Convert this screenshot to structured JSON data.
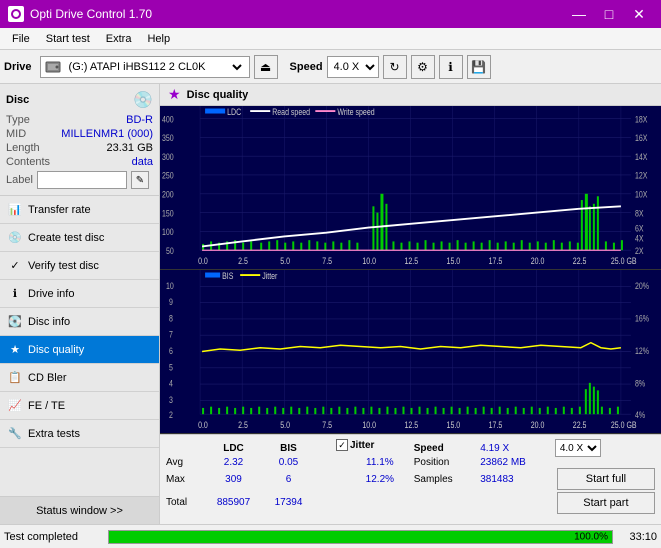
{
  "titlebar": {
    "title": "Opti Drive Control 1.70",
    "minimize": "—",
    "maximize": "□",
    "close": "✕"
  },
  "menu": {
    "items": [
      "File",
      "Start test",
      "Extra",
      "Help"
    ]
  },
  "toolbar": {
    "drive_label": "Drive",
    "drive_value": "(G:) ATAPI iHBS112  2 CL0K",
    "speed_label": "Speed",
    "speed_value": "4.0 X"
  },
  "disc_info": {
    "type_label": "Type",
    "type_value": "BD-R",
    "mid_label": "MID",
    "mid_value": "MILLENMR1 (000)",
    "length_label": "Length",
    "length_value": "23.31 GB",
    "contents_label": "Contents",
    "contents_value": "data",
    "label_label": "Label"
  },
  "nav_items": [
    {
      "label": "Transfer rate",
      "icon": "📊",
      "active": false
    },
    {
      "label": "Create test disc",
      "icon": "💿",
      "active": false
    },
    {
      "label": "Verify test disc",
      "icon": "✓",
      "active": false
    },
    {
      "label": "Drive info",
      "icon": "ℹ",
      "active": false
    },
    {
      "label": "Disc info",
      "icon": "💽",
      "active": false
    },
    {
      "label": "Disc quality",
      "icon": "★",
      "active": true
    },
    {
      "label": "CD Bler",
      "icon": "📋",
      "active": false
    },
    {
      "label": "FE / TE",
      "icon": "📈",
      "active": false
    },
    {
      "label": "Extra tests",
      "icon": "🔧",
      "active": false
    }
  ],
  "status_window": "Status window >>",
  "disc_quality": {
    "title": "Disc quality",
    "legend": {
      "ldc": "LDC",
      "read_speed": "Read speed",
      "write_speed": "Write speed"
    },
    "chart1": {
      "y_max": 400,
      "y_right_labels": [
        "18X",
        "16X",
        "14X",
        "12X",
        "10X",
        "8X",
        "6X",
        "4X",
        "2X"
      ],
      "x_labels": [
        "0.0",
        "2.5",
        "5.0",
        "7.5",
        "10.0",
        "12.5",
        "15.0",
        "17.5",
        "20.0",
        "22.5",
        "25.0 GB"
      ]
    },
    "chart2": {
      "title": "BIS",
      "title2": "Jitter",
      "y_max": 10,
      "y_right_labels": [
        "20%",
        "16%",
        "12%",
        "8%",
        "4%"
      ],
      "x_labels": [
        "0.0",
        "2.5",
        "5.0",
        "7.5",
        "10.0",
        "12.5",
        "15.0",
        "17.5",
        "20.0",
        "22.5",
        "25.0 GB"
      ]
    }
  },
  "stats": {
    "headers": [
      "LDC",
      "BIS",
      "",
      "Jitter",
      "Speed",
      ""
    ],
    "avg_label": "Avg",
    "avg_ldc": "2.32",
    "avg_bis": "0.05",
    "avg_jitter": "11.1%",
    "max_label": "Max",
    "max_ldc": "309",
    "max_bis": "6",
    "max_jitter": "12.2%",
    "total_label": "Total",
    "total_ldc": "885907",
    "total_bis": "17394",
    "jitter_checked": true,
    "speed_label": "Speed",
    "speed_value": "4.19 X",
    "speed_select": "4.0 X",
    "position_label": "Position",
    "position_value": "23862 MB",
    "samples_label": "Samples",
    "samples_value": "381483",
    "start_full": "Start full",
    "start_part": "Start part"
  },
  "statusbar": {
    "text": "Test completed",
    "progress": 100,
    "progress_text": "100.0%",
    "time": "33:10"
  },
  "colors": {
    "ldc_bar": "#00cc00",
    "read_speed": "#ffffff",
    "write_speed": "#ff69b4",
    "bis_bar": "#00cc00",
    "jitter_line": "#ffff00",
    "chart_bg": "#00004a",
    "grid_line": "#333366",
    "accent": "#9c00b0",
    "active_nav": "#0078d7"
  }
}
